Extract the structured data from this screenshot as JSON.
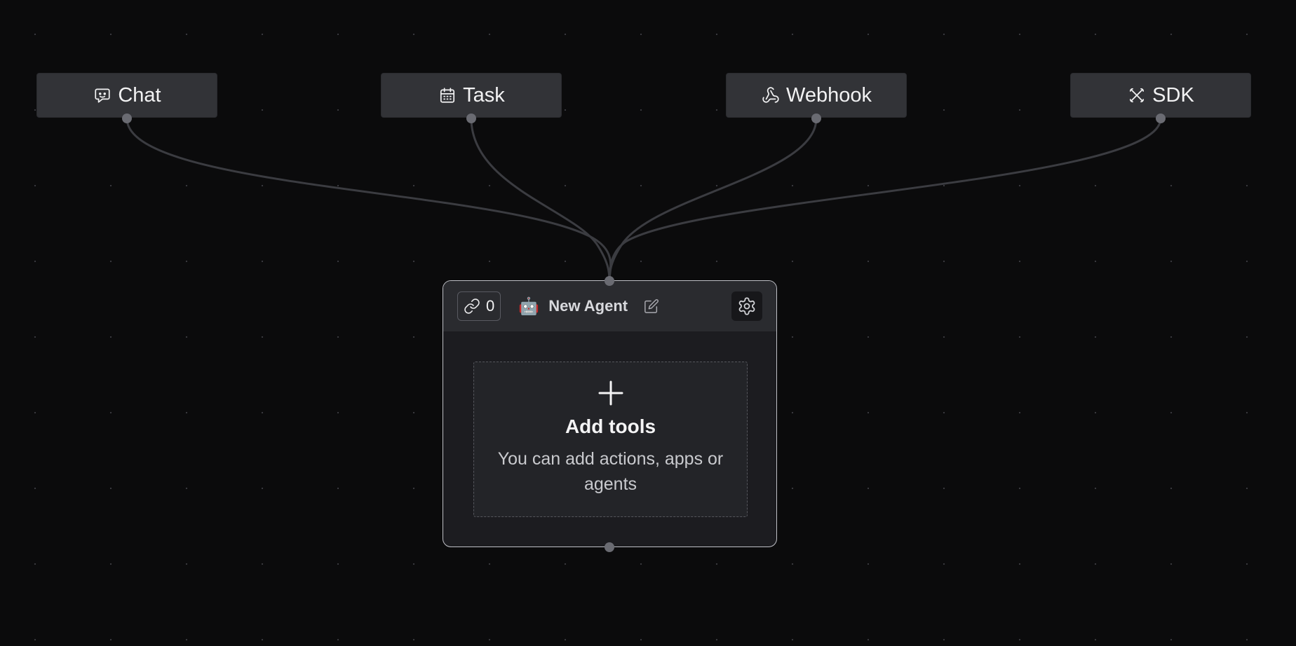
{
  "triggers": [
    {
      "id": "chat",
      "label": "Chat",
      "icon": "chat-bot-icon"
    },
    {
      "id": "task",
      "label": "Task",
      "icon": "calendar-icon"
    },
    {
      "id": "webhook",
      "label": "Webhook",
      "icon": "webhook-icon"
    },
    {
      "id": "sdk",
      "label": "SDK",
      "icon": "sdk-icon"
    }
  ],
  "agent": {
    "link_count": "0",
    "emoji": "🤖",
    "name": "New Agent"
  },
  "add_tools": {
    "title": "Add tools",
    "description": "You can add actions, apps or agents"
  },
  "colors": {
    "background": "#0b0b0c",
    "node": "#323337",
    "edge": "#3b3c41",
    "handle": "#6a6b72",
    "agent_border": "#bfc0c6"
  }
}
